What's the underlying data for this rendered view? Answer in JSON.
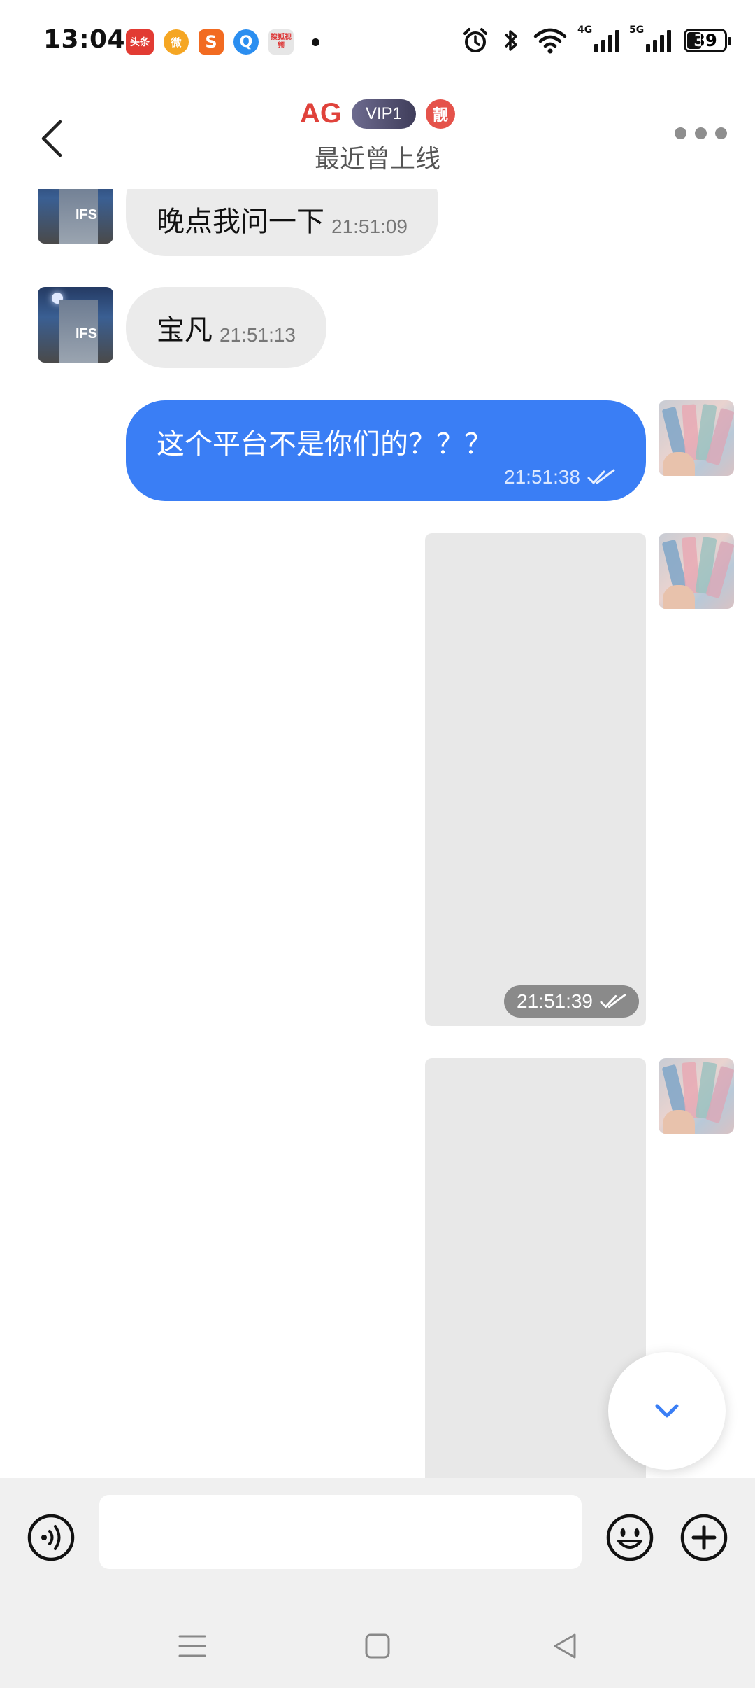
{
  "status_bar": {
    "time": "13:04",
    "notification_apps": [
      {
        "name": "toutiao-icon",
        "text": "头条",
        "color": "#e23b33"
      },
      {
        "name": "weibo-icon",
        "text": "微",
        "color": "#f5a623"
      },
      {
        "name": "sogou-icon",
        "text": "S",
        "color": "#f26b21"
      },
      {
        "name": "qq-browser-icon",
        "text": "Q",
        "color": "#2b8ef0"
      },
      {
        "name": "sohu-video-icon",
        "text": "搜狐视频",
        "color": "#e6e6e6"
      }
    ],
    "network_4g": "4G",
    "network_5g": "5G",
    "battery": "39"
  },
  "header": {
    "title": "AG",
    "vip_badge": "VIP1",
    "liang_badge": "靓",
    "subtitle": "最近曾上线"
  },
  "messages": [
    {
      "direction": "in",
      "text": "晚点我问一下",
      "time": "21:51:09"
    },
    {
      "direction": "in",
      "text": "宝凡",
      "time": "21:51:13"
    },
    {
      "direction": "out",
      "text": "这个平台不是你们的？？？",
      "time": "21:51:38"
    },
    {
      "direction": "out",
      "type": "image",
      "time": "21:51:39"
    },
    {
      "direction": "out",
      "type": "image",
      "time": ""
    }
  ],
  "input": {
    "placeholder": ""
  },
  "colors": {
    "accent": "#3a7ef5",
    "title_red": "#e0423b",
    "incoming_bubble": "#ebebeb"
  }
}
